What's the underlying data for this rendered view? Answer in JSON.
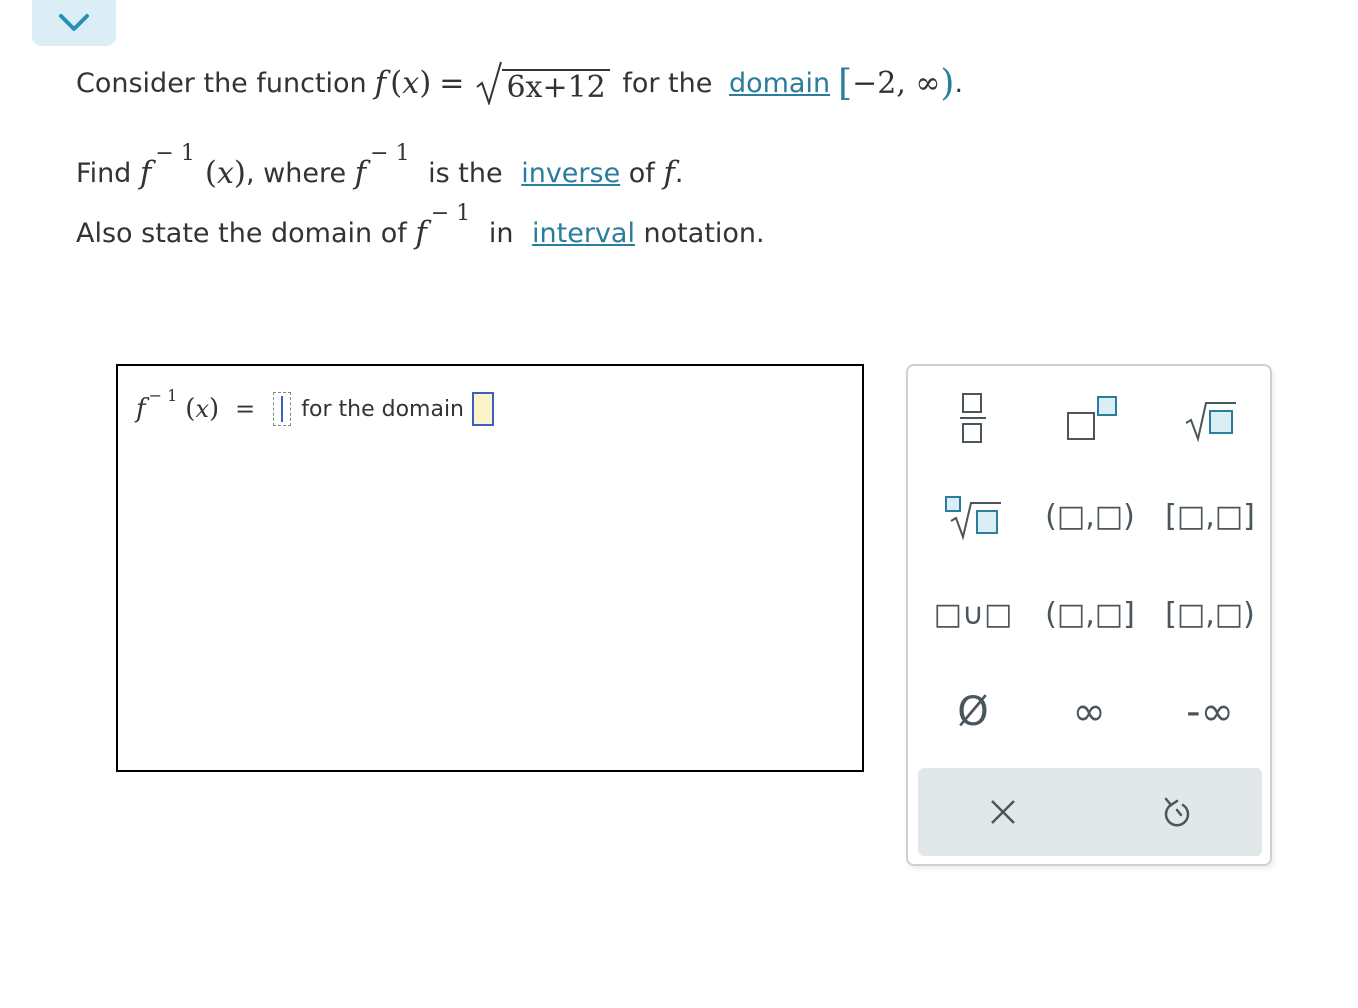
{
  "nav": {
    "collapse_icon": "chevron-down-icon",
    "accent": "#dbeef5"
  },
  "question": {
    "line1": {
      "prefix": "Consider the function ",
      "f": "f",
      "var": "x",
      "equals": "=",
      "radicand": "6x+12",
      "mid": " for the ",
      "domain_link": "domain",
      "interval": "−2, ∞",
      "suffix": "."
    },
    "line2": {
      "prefix": "Find ",
      "f": "f",
      "inv_exp": "− 1",
      "var": "x",
      "comma": ", where ",
      "is_the": " is the ",
      "inverse_link": "inverse",
      "of": " of ",
      "end": "."
    },
    "line3": {
      "prefix": "Also state the domain of ",
      "f": "f",
      "inv_exp": "− 1",
      "in": " in ",
      "interval_link": "interval",
      "suffix": " notation."
    }
  },
  "answer": {
    "f": "f",
    "inv_exp": "− 1",
    "var": "x",
    "equals": "=",
    "domain_label": "for the domain"
  },
  "toolbox": {
    "buttons": [
      {
        "name": "fraction-button",
        "icon": "fraction-icon"
      },
      {
        "name": "exponent-button",
        "icon": "superscript-icon"
      },
      {
        "name": "sqrt-button",
        "icon": "square-root-icon"
      },
      {
        "name": "nth-root-button",
        "icon": "nth-root-icon"
      },
      {
        "name": "open-interval-button",
        "label": "(□,□)"
      },
      {
        "name": "closed-interval-button",
        "label": "[□,□]"
      },
      {
        "name": "union-button",
        "label": "□∪□"
      },
      {
        "name": "left-open-interval-button",
        "label": "(□,□]"
      },
      {
        "name": "right-open-interval-button",
        "label": "[□,□)"
      },
      {
        "name": "empty-set-button",
        "label": "Ø"
      },
      {
        "name": "infinity-button",
        "label": "∞"
      },
      {
        "name": "neg-infinity-button",
        "label": "-∞"
      }
    ],
    "clear_icon": "close-icon",
    "undo_icon": "undo-icon"
  },
  "colors": {
    "link": "#2a7d9c",
    "slot_border": "#3a60c8",
    "slot_fill": "#fdf3c8"
  }
}
